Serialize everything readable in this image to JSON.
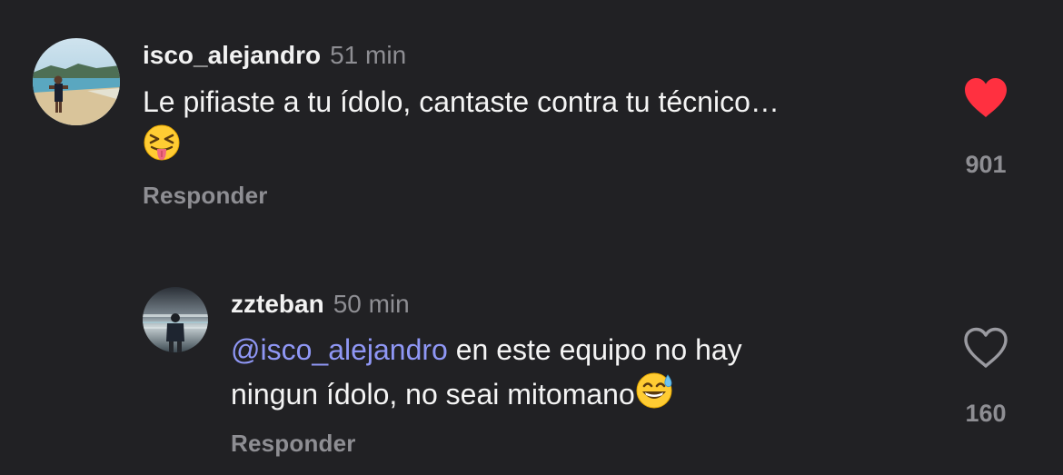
{
  "comments": [
    {
      "username": "isco_alejandro",
      "time": "51 min",
      "text": "Le pifiaste a tu ídolo, cantaste contra tu técnico…",
      "emoji": "squinting-face-with-tongue",
      "reply_label": "Responder",
      "likes": "901",
      "liked": true
    },
    {
      "username": "zzteban",
      "time": "50 min",
      "mention": "@isco_alejandro",
      "text_line1": " en este equipo no hay",
      "text_line2": "ningun ídolo, no seai mitomano",
      "emoji": "grinning-face-with-sweat",
      "reply_label": "Responder",
      "likes": "160",
      "liked": false
    }
  ],
  "colors": {
    "background": "#212124",
    "heart_liked": "#ff3040",
    "mention": "#8f97f5",
    "muted": "#8e8e93"
  }
}
